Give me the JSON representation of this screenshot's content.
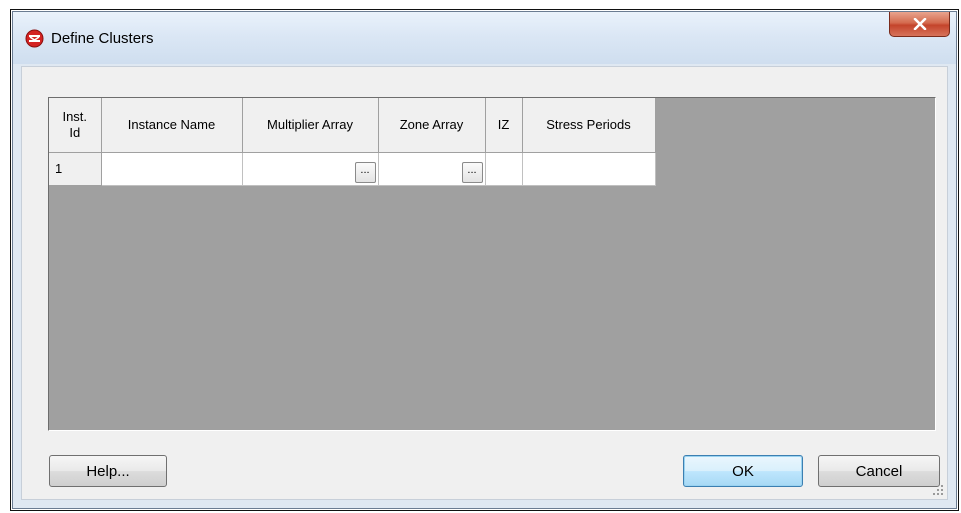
{
  "window": {
    "title": "Define Clusters",
    "close_label": "X",
    "icon": "app-logo-icon"
  },
  "grid": {
    "columns": [
      {
        "label": "Inst.\nId"
      },
      {
        "label": "Instance Name"
      },
      {
        "label": "Multiplier Array"
      },
      {
        "label": "Zone Array"
      },
      {
        "label": "IZ"
      },
      {
        "label": "Stress Periods"
      }
    ],
    "rows": [
      {
        "id": "1",
        "instance_name": "",
        "multiplier_array": "",
        "multiplier_button": "...",
        "zone_array": "",
        "zone_button": "...",
        "iz": "",
        "stress_periods": ""
      }
    ]
  },
  "buttons": {
    "help": "Help...",
    "ok": "OK",
    "cancel": "Cancel"
  },
  "colors": {
    "grid_background": "#a0a0a0",
    "close_button": "#c4442b",
    "default_button_border": "#3c7fb1"
  }
}
